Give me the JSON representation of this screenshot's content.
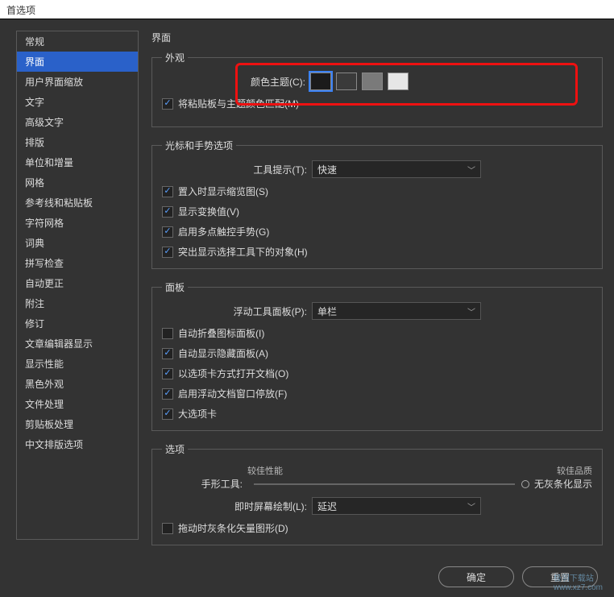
{
  "window": {
    "title": "首选项"
  },
  "sidebar": {
    "items": [
      {
        "label": "常规"
      },
      {
        "label": "界面"
      },
      {
        "label": "用户界面缩放"
      },
      {
        "label": "文字"
      },
      {
        "label": "高级文字"
      },
      {
        "label": "排版"
      },
      {
        "label": "单位和增量"
      },
      {
        "label": "网格"
      },
      {
        "label": "参考线和粘贴板"
      },
      {
        "label": "字符网格"
      },
      {
        "label": "词典"
      },
      {
        "label": "拼写检查"
      },
      {
        "label": "自动更正"
      },
      {
        "label": "附注"
      },
      {
        "label": "修订"
      },
      {
        "label": "文章编辑器显示"
      },
      {
        "label": "显示性能"
      },
      {
        "label": "黑色外观"
      },
      {
        "label": "文件处理"
      },
      {
        "label": "剪贴板处理"
      },
      {
        "label": "中文排版选项"
      }
    ],
    "selected_index": 1
  },
  "main": {
    "heading": "界面",
    "appearance": {
      "legend": "外观",
      "color_theme_label": "颜色主题(C):",
      "swatches": [
        "#1b1b1b",
        "#3a3a3a",
        "#7a7a7a",
        "#e6e6e6"
      ],
      "selected_swatch": 0,
      "match_pasteboard": {
        "checked": true,
        "label": "将粘贴板与主题颜色匹配(M)"
      }
    },
    "cursor": {
      "legend": "光标和手势选项",
      "tooltip_label": "工具提示(T):",
      "tooltip_value": "快速",
      "thumb": {
        "checked": true,
        "label": "置入时显示缩览图(S)"
      },
      "transform": {
        "checked": true,
        "label": "显示变换值(V)"
      },
      "multitouch": {
        "checked": true,
        "label": "启用多点触控手势(G)"
      },
      "highlight": {
        "checked": true,
        "label": "突出显示选择工具下的对象(H)"
      }
    },
    "panels": {
      "legend": "面板",
      "float_label": "浮动工具面板(P):",
      "float_value": "单栏",
      "autocollapse": {
        "checked": false,
        "label": "自动折叠图标面板(I)"
      },
      "autoshow": {
        "checked": true,
        "label": "自动显示隐藏面板(A)"
      },
      "tabs": {
        "checked": true,
        "label": "以选项卡方式打开文档(O)"
      },
      "dock": {
        "checked": true,
        "label": "启用浮动文档窗口停放(F)"
      },
      "bigtabs": {
        "checked": true,
        "label": "大选项卡"
      }
    },
    "options": {
      "legend": "选项",
      "hand_label": "手形工具:",
      "perf_left": "较佳性能",
      "perf_right": "较佳品质",
      "greek_label": "无灰条化显示",
      "live_label": "即时屏幕绘制(L):",
      "live_value": "延迟",
      "greek_vector": {
        "checked": false,
        "label": "拖动时灰条化矢量图形(D)"
      }
    }
  },
  "footer": {
    "ok": "确定",
    "cancel": "重置"
  },
  "watermark": {
    "line1": "极羽下载站",
    "line2": "www.xz7.com"
  }
}
